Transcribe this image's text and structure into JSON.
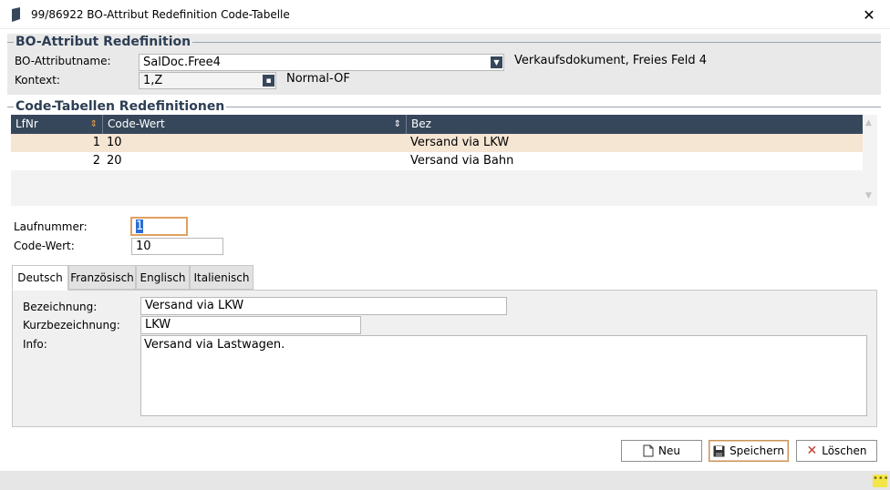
{
  "window": {
    "title": "99/86922 BO-Attribut Redefinition Code-Tabelle",
    "close_glyph": "✕"
  },
  "section1": {
    "title": "BO-Attribut Redefinition",
    "attr_label": "BO-Attributname:",
    "attr_value": "SalDoc.Free4",
    "attr_desc": "Verkaufsdokument, Freies Feld 4",
    "ctx_label": "Kontext:",
    "ctx_value": "1,Z",
    "ctx_desc": "Normal-OF"
  },
  "section2": {
    "title": "Code-Tabellen Redefinitionen",
    "columns": [
      "LfNr",
      "Code-Wert",
      "Bez"
    ],
    "rows": [
      {
        "lfnr": "1",
        "code": "10",
        "bez": "Versand via LKW",
        "selected": true
      },
      {
        "lfnr": "2",
        "code": "20",
        "bez": "Versand via Bahn",
        "selected": false
      }
    ]
  },
  "detail": {
    "lauf_label": "Laufnummer:",
    "lauf_value": "1",
    "code_label": "Code-Wert:",
    "code_value": "10"
  },
  "tabs": [
    {
      "label": "Deutsch",
      "active": true
    },
    {
      "label": "Französisch",
      "active": false
    },
    {
      "label": "Englisch",
      "active": false
    },
    {
      "label": "Italienisch",
      "active": false
    }
  ],
  "tab_content": {
    "bez_label": "Bezeichnung:",
    "bez_value": "Versand via LKW",
    "kurz_label": "Kurzbezeichnung:",
    "kurz_value": "LKW",
    "info_label": "Info:",
    "info_value": "Versand via Lastwagen."
  },
  "buttons": {
    "new": "Neu",
    "save": "Speichern",
    "delete": "Löschen"
  },
  "colors": {
    "header_bg": "#37475b",
    "selected_row": "#f5e5d3",
    "section_title": "#2d3e55",
    "focus_border": "#e0a060",
    "delete_icon": "#c0392b"
  }
}
